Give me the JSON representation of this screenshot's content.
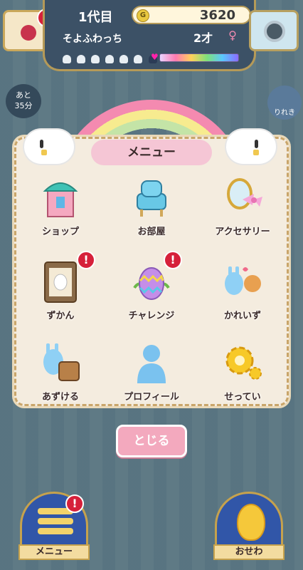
{
  "header": {
    "generation": "1代目",
    "coins": "3620",
    "coin_symbol": "G",
    "pet_name": "そよふわっち",
    "age": "2才",
    "gender_symbol": "♀"
  },
  "timer": {
    "line1": "あと",
    "line2": "35分"
  },
  "side_right": {
    "label": "りれき"
  },
  "menu": {
    "title": "メニュー",
    "items": [
      {
        "label": "ショップ",
        "icon": "shop-icon",
        "alert": false
      },
      {
        "label": "お部屋",
        "icon": "room-icon",
        "alert": false
      },
      {
        "label": "アクセサリー",
        "icon": "accessory-icon",
        "alert": false
      },
      {
        "label": "ずかん",
        "icon": "encyclopedia-icon",
        "alert": true
      },
      {
        "label": "チャレンジ",
        "icon": "challenge-egg-icon",
        "alert": true
      },
      {
        "label": "かれいず",
        "icon": "family-tree-icon",
        "alert": false
      },
      {
        "label": "あずける",
        "icon": "deposit-icon",
        "alert": false
      },
      {
        "label": "プロフィール",
        "icon": "profile-icon",
        "alert": false
      },
      {
        "label": "せってい",
        "icon": "settings-gear-icon",
        "alert": false
      }
    ],
    "close_label": "とじる"
  },
  "bottom_nav": {
    "menu_label": "メニュー",
    "care_label": "おせわ"
  },
  "alert_glyph": "!"
}
